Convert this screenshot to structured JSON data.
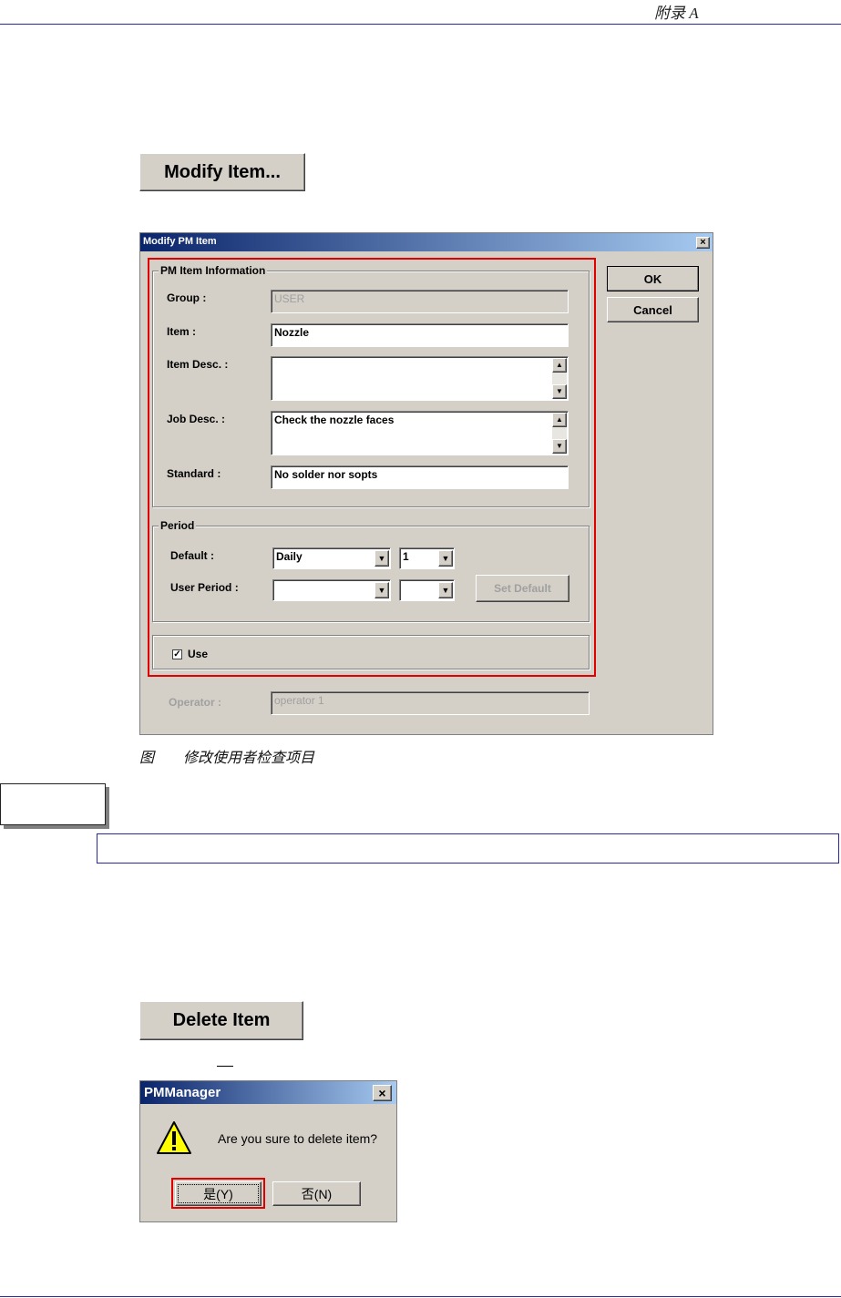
{
  "page_header": {
    "text": "附录 A"
  },
  "modify_button": {
    "label": "Modify Item..."
  },
  "modify_dialog": {
    "title": "Modify PM Item",
    "close_glyph": "×",
    "ok_label": "OK",
    "cancel_label": "Cancel",
    "info_group": {
      "legend": "PM Item Information",
      "group_label": "Group :",
      "group_value": "USER",
      "item_label": "Item :",
      "item_value": "Nozzle",
      "item_desc_label": "Item Desc. :",
      "item_desc_value": "",
      "job_desc_label": "Job Desc. :",
      "job_desc_value": "Check the nozzle faces",
      "standard_label": "Standard :",
      "standard_value": "No solder nor sopts"
    },
    "period_group": {
      "legend": "Period",
      "default_label": "Default :",
      "default_unit_value": "Daily",
      "default_count_value": "1",
      "user_period_label": "User Period :",
      "user_unit_value": "",
      "user_count_value": "",
      "set_default_label": "Set Default"
    },
    "use_label": "Use",
    "use_checked": true,
    "operator_label": "Operator :",
    "operator_value": "operator 1",
    "highlight_color": "#e00000"
  },
  "figure_caption": "图　　修改使用者检查项目",
  "delete_button": {
    "label": "Delete Item"
  },
  "confirm_dialog": {
    "title": "PMManager",
    "close_glyph": "×",
    "message": "Are you sure to delete item?",
    "yes_label": "是(Y)",
    "no_label": "否(N)",
    "icon": "warning-icon"
  }
}
